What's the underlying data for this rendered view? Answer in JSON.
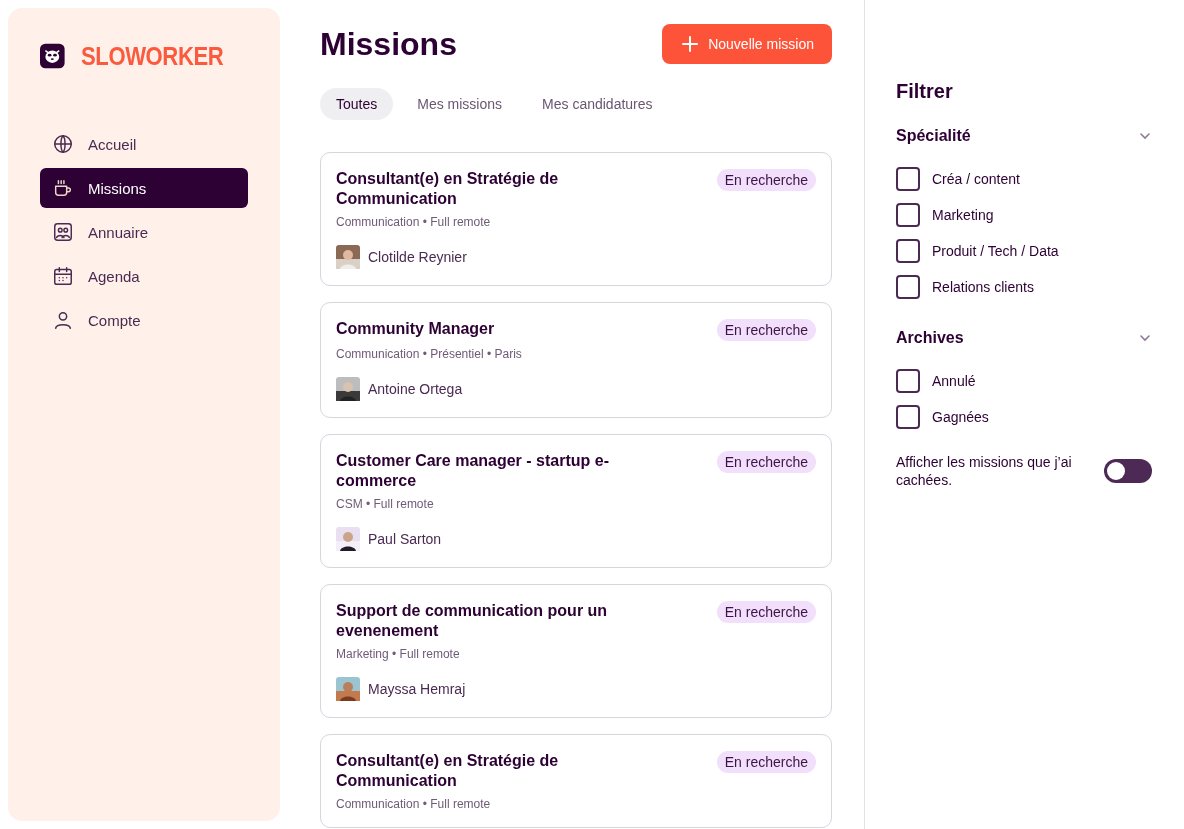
{
  "brand": "SLOWORKER",
  "nav": [
    {
      "label": "Accueil",
      "selected": false
    },
    {
      "label": "Missions",
      "selected": true
    },
    {
      "label": "Annuaire",
      "selected": false
    },
    {
      "label": "Agenda",
      "selected": false
    },
    {
      "label": "Compte",
      "selected": false
    }
  ],
  "page_title": "Missions",
  "new_button": "Nouvelle mission",
  "tabs": [
    {
      "label": "Toutes",
      "selected": true
    },
    {
      "label": "Mes missions",
      "selected": false
    },
    {
      "label": "Mes candidatures",
      "selected": false
    }
  ],
  "missions": [
    {
      "title": "Consultant(e) en Stratégie de Communication",
      "status": "En recherche",
      "meta": "Communication • Full remote",
      "person": "Clotilde Reynier"
    },
    {
      "title": "Community Manager",
      "status": "En recherche",
      "meta": "Communication • Présentiel • Paris",
      "person": "Antoine Ortega"
    },
    {
      "title": "Customer Care manager - startup e-commerce",
      "status": "En recherche",
      "meta": "CSM • Full remote",
      "person": "Paul Sarton"
    },
    {
      "title": "Support de communication pour un evenenement",
      "status": "En recherche",
      "meta": "Marketing • Full remote",
      "person": "Mayssa Hemraj"
    },
    {
      "title": "Consultant(e) en Stratégie de Communication",
      "status": "En recherche",
      "meta": "Communication • Full remote"
    }
  ],
  "filter": {
    "title": "Filtrer",
    "sections": [
      {
        "title": "Spécialité",
        "expanded": true,
        "options": [
          {
            "label": "Créa / content",
            "checked": false
          },
          {
            "label": "Marketing",
            "checked": false
          },
          {
            "label": "Produit / Tech / Data",
            "checked": false
          },
          {
            "label": "Relations clients",
            "checked": false
          }
        ]
      },
      {
        "title": "Archives",
        "expanded": true,
        "options": [
          {
            "label": "Annulé",
            "checked": false
          },
          {
            "label": "Gagnées",
            "checked": false
          }
        ]
      }
    ],
    "hidden_toggle": {
      "label": "Afficher les missions que j’ai cachées.",
      "on": false
    }
  }
}
